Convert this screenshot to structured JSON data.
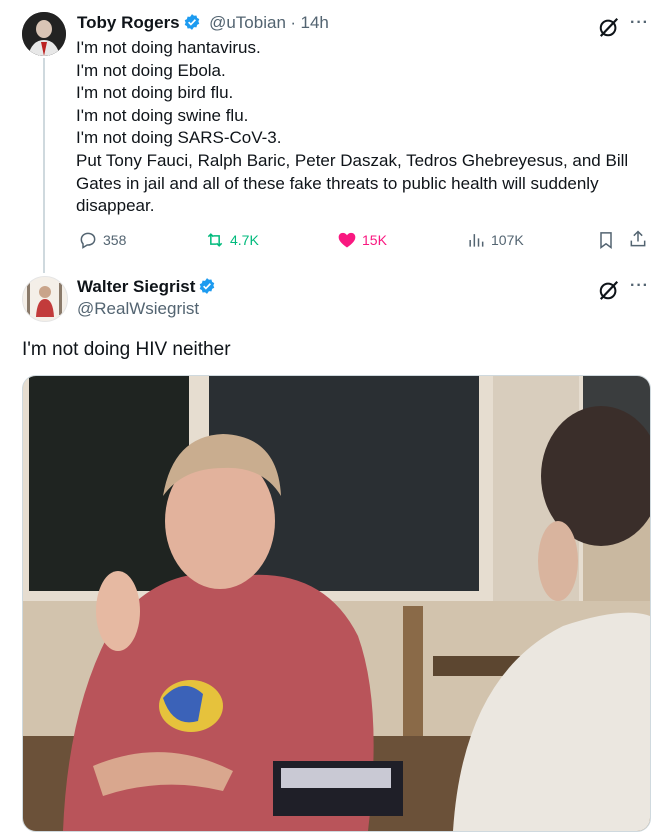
{
  "parent_tweet": {
    "author_name": "Toby Rogers",
    "handle": "@uTobian",
    "separator": "·",
    "time": "14h",
    "lines": [
      "I'm not doing hantavirus.",
      "I'm not doing Ebola.",
      "I'm not doing bird flu.",
      "I'm not doing swine flu.",
      "I'm not doing SARS-CoV-3.",
      "Put Tony Fauci, Ralph Baric, Peter Daszak, Tedros Ghebreyesus, and Bill",
      "Gates in jail and all of these fake threats to public health will suddenly",
      "disappear."
    ],
    "replies": "358",
    "reposts": "4.7K",
    "likes": "15K",
    "views": "107K"
  },
  "reply_tweet": {
    "author_name": "Walter Siegrist",
    "handle": "@RealWsiegrist",
    "text": "I'm not doing HIV neither"
  },
  "colors": {
    "verified": "#1d9bf0",
    "repost_active": "#00ba7c",
    "like_active": "#f91880",
    "secondary_text": "#536471"
  },
  "icons": [
    "grok-icon",
    "more-icon",
    "reply-icon",
    "repost-icon",
    "heart-icon",
    "views-icon",
    "bookmark-icon",
    "share-icon",
    "verified-badge-icon"
  ]
}
